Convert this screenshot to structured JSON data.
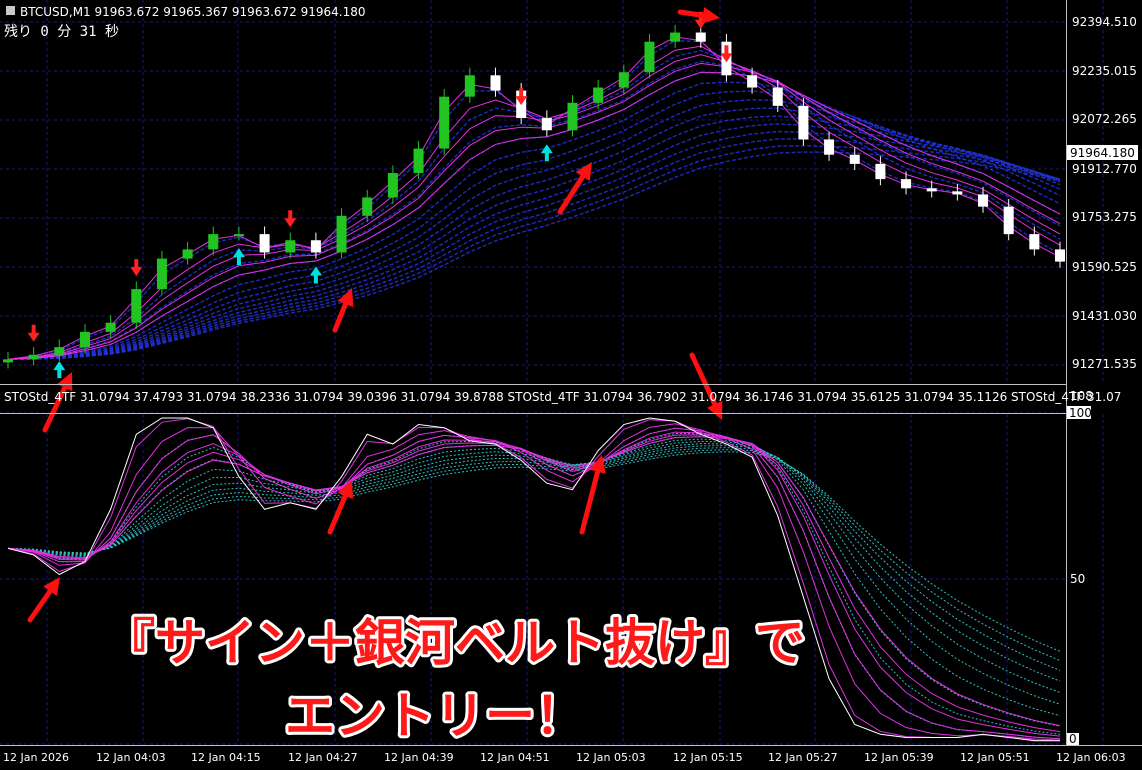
{
  "window": {
    "symbol_header": "BTCUSD,M1  91963.672 91965.367 91963.672 91964.180",
    "timer": "残り  0 分  31 秒"
  },
  "price_axis": {
    "ticks": [
      "92394.510",
      "92235.015",
      "92072.265",
      "91912.770",
      "91753.275",
      "91590.525",
      "91431.030",
      "91271.535"
    ],
    "current_price": "91964.180"
  },
  "indicator": {
    "header": "STOStd_4TF 31.0794 37.4793 31.0794 38.2336 31.0794 39.0396 31.0794 39.8788  STOStd_4TF 31.0794 36.7902 31.0794 36.1746 31.0794 35.6125 31.0794 35.1126  STOStd_4TF 31.07",
    "axis_ticks": [
      "108",
      "100",
      "50",
      "0"
    ]
  },
  "time_axis": {
    "labels": [
      "12 Jan 2026",
      "12 Jan 04:03",
      "12 Jan 04:15",
      "12 Jan 04:27",
      "12 Jan 04:39",
      "12 Jan 04:51",
      "12 Jan 05:03",
      "12 Jan 05:15",
      "12 Jan 05:27",
      "12 Jan 05:39",
      "12 Jan 05:51",
      "12 Jan 06:03"
    ]
  },
  "annotation": {
    "line1": "『サイン＋銀河ベルト抜け』で",
    "line2": "エントリー！"
  },
  "colors": {
    "background": "#000000",
    "grid": "#1a1a6e",
    "bull_candle": "#22c422",
    "bear_candle": "#ffffff",
    "ma_ribbon": "#e030e0",
    "galaxy_belt": "#2233dd",
    "buy_signal": "#00e0e0",
    "sell_signal": "#ff2020",
    "arrow": "#ff1010",
    "stoch_band": "#30c0c0"
  },
  "chart_data": [
    {
      "type": "candlestick",
      "title": "BTCUSD,M1",
      "x": [
        "04:00",
        "04:03",
        "04:06",
        "04:09",
        "04:12",
        "04:15",
        "04:18",
        "04:21",
        "04:24",
        "04:27",
        "04:30",
        "04:33",
        "04:36",
        "04:39",
        "04:42",
        "04:45",
        "04:48",
        "04:51",
        "04:54",
        "04:57",
        "05:00",
        "05:03",
        "05:06",
        "05:09",
        "05:12",
        "05:15",
        "05:18",
        "05:21",
        "05:24",
        "05:27",
        "05:30",
        "05:33",
        "05:36",
        "05:39",
        "05:42",
        "05:45",
        "05:48",
        "05:51",
        "05:54",
        "05:57",
        "06:00",
        "06:03"
      ],
      "close": [
        91290,
        91305,
        91330,
        91380,
        91410,
        91520,
        91620,
        91650,
        91700,
        91700,
        91640,
        91680,
        91640,
        91760,
        91820,
        91900,
        91980,
        92150,
        92220,
        92170,
        92080,
        92040,
        92130,
        92180,
        92230,
        92330,
        92360,
        92330,
        92220,
        92180,
        92120,
        92010,
        91960,
        91930,
        91880,
        91850,
        91840,
        91830,
        91790,
        91700,
        91650,
        91610
      ],
      "buy_signals_x": [
        "04:06",
        "04:27",
        "04:36",
        "05:03"
      ],
      "sell_signals_x": [
        "04:03",
        "04:15",
        "04:33",
        "05:00",
        "05:21",
        "05:24"
      ],
      "ylim": [
        91200,
        92460
      ],
      "grid": true
    },
    {
      "type": "line",
      "title": "STOStd_4TF",
      "x": [
        "04:00",
        "04:03",
        "04:06",
        "04:09",
        "04:12",
        "04:15",
        "04:18",
        "04:21",
        "04:24",
        "04:27",
        "04:30",
        "04:33",
        "04:36",
        "04:39",
        "04:42",
        "04:45",
        "04:48",
        "04:51",
        "04:54",
        "04:57",
        "05:00",
        "05:03",
        "05:06",
        "05:09",
        "05:12",
        "05:15",
        "05:18",
        "05:21",
        "05:24",
        "05:27",
        "05:30",
        "05:33",
        "05:36",
        "05:39",
        "05:42",
        "05:45",
        "05:48",
        "05:51",
        "05:54",
        "05:57",
        "06:00",
        "06:03"
      ],
      "series": [
        {
          "values": [
            60,
            58,
            52,
            56,
            72,
            95,
            100,
            100,
            97,
            82,
            72,
            74,
            72,
            82,
            95,
            92,
            98,
            97,
            93,
            92,
            87,
            80,
            78,
            90,
            98,
            100,
            99,
            95,
            92,
            88,
            70,
            45,
            20,
            6,
            3,
            2,
            2,
            2,
            3,
            2,
            1,
            1
          ]
        }
      ],
      "ylim": [
        0,
        100
      ],
      "grid": true
    }
  ]
}
